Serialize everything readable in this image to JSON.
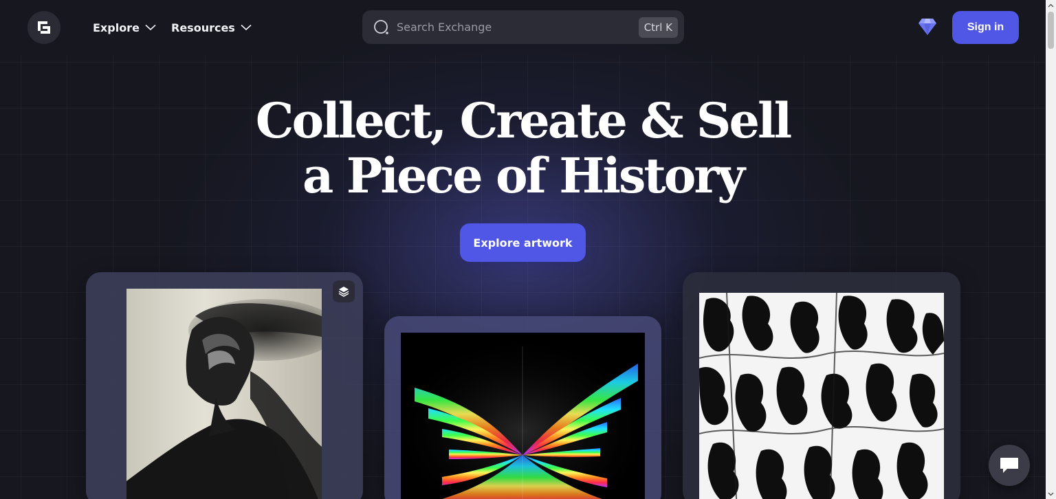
{
  "header": {
    "logo_icon": "exchange-logo-icon",
    "nav": [
      {
        "label": "Explore",
        "icon": "chevron-down-icon"
      },
      {
        "label": "Resources",
        "icon": "chevron-down-icon"
      }
    ],
    "search": {
      "placeholder": "Search Exchange",
      "shortcut": "Ctrl K",
      "icon": "search-icon"
    },
    "gem_icon": "gem-icon",
    "signin_label": "Sign in"
  },
  "hero": {
    "headline_line1": "Collect, Create & Sell",
    "headline_line2": "a Piece of History",
    "cta_label": "Explore artwork"
  },
  "cards": [
    {
      "art": "monochrome-portrait-artwork",
      "badge_icon": "layers-icon"
    },
    {
      "art": "rainbow-light-rays-artwork"
    },
    {
      "art": "black-white-abstract-figures-artwork"
    }
  ],
  "chat_icon": "chat-bubble-icon",
  "colors": {
    "background": "#16171f",
    "accent": "#5056e6",
    "search_bg": "#2b2c35",
    "card_bg": "#3e3f5c"
  }
}
